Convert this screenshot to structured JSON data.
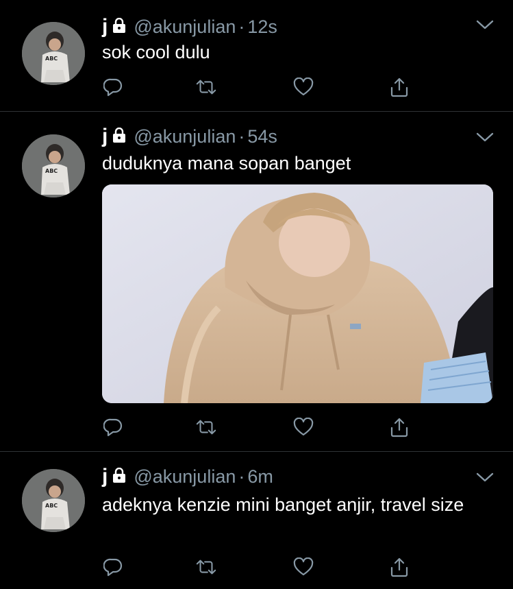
{
  "tweets": [
    {
      "name": "j",
      "handle": "@akunjulian",
      "separator": "·",
      "time": "12s",
      "text": "sok cool dulu",
      "has_media": false
    },
    {
      "name": "j",
      "handle": "@akunjulian",
      "separator": "·",
      "time": "54s",
      "text": "duduknya mana sopan banget",
      "has_media": true
    },
    {
      "name": "j",
      "handle": "@akunjulian",
      "separator": "·",
      "time": "6m",
      "text": "adeknya kenzie mini banget anjir, travel size",
      "has_media": false
    }
  ],
  "avatar_text": "ABC",
  "icons": {
    "protected": "lock-icon",
    "more": "chevron-down-icon",
    "reply": "reply-icon",
    "retweet": "retweet-icon",
    "like": "heart-icon",
    "share": "share-icon"
  },
  "colors": {
    "background": "#000000",
    "text": "#ffffff",
    "secondary": "#8899a6",
    "divider": "#2f3336"
  }
}
